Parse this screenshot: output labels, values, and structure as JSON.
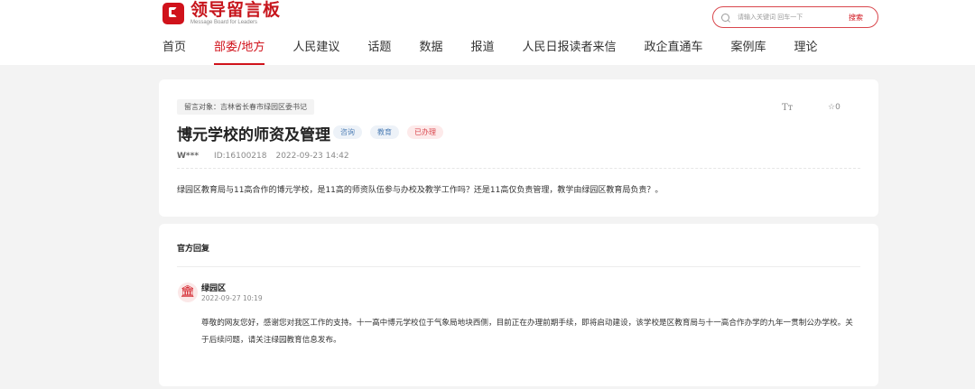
{
  "header": {
    "logo_title": "领导留言板",
    "logo_subtitle": "Message Board for Leaders",
    "search": {
      "placeholder": "请输入关键词 回车一下",
      "button": "搜索"
    }
  },
  "nav": {
    "items": [
      {
        "label": "首页"
      },
      {
        "label": "部委/地方",
        "active": true
      },
      {
        "label": "人民建议"
      },
      {
        "label": "话题"
      },
      {
        "label": "数据"
      },
      {
        "label": "报道"
      },
      {
        "label": "人民日报读者来信"
      },
      {
        "label": "政企直通车"
      },
      {
        "label": "案例库"
      },
      {
        "label": "理论"
      }
    ]
  },
  "message": {
    "target": "留言对象：吉林省长春市绿园区委书记",
    "title": "博元学校的师资及管理",
    "tags": [
      {
        "label": "咨询",
        "color": "#4f7fb6"
      },
      {
        "label": "教育",
        "color": "#4f7fb6"
      },
      {
        "label": "已办理",
        "color": "#d9474d"
      }
    ],
    "user": "W***",
    "id": "ID:16100218",
    "datetime": "2022-09-23 14:42",
    "font_icon": "Tт",
    "star_count": "☆0",
    "content": "绿园区教育局与11高合作的博元学校，是11高的师资队伍参与办校及教学工作吗？还是11高仅负责管理，教学由绿园区教育局负责？。"
  },
  "reply": {
    "heading": "官方回复",
    "department": "绿园区",
    "date": "2022-09-27 10:19",
    "avatar_icon": "building-icon",
    "text": "尊敬的网友您好，感谢您对我区工作的支持。十一高中博元学校位于气象局地块西侧，目前正在办理前期手续，即将启动建设，该学校是区教育局与十一高合作办学的九年一贯制公办学校。关于后续问题，请关注绿园教育信息发布。"
  },
  "colors": {
    "brand": "#d0121b",
    "background": "#f3f3f3"
  }
}
